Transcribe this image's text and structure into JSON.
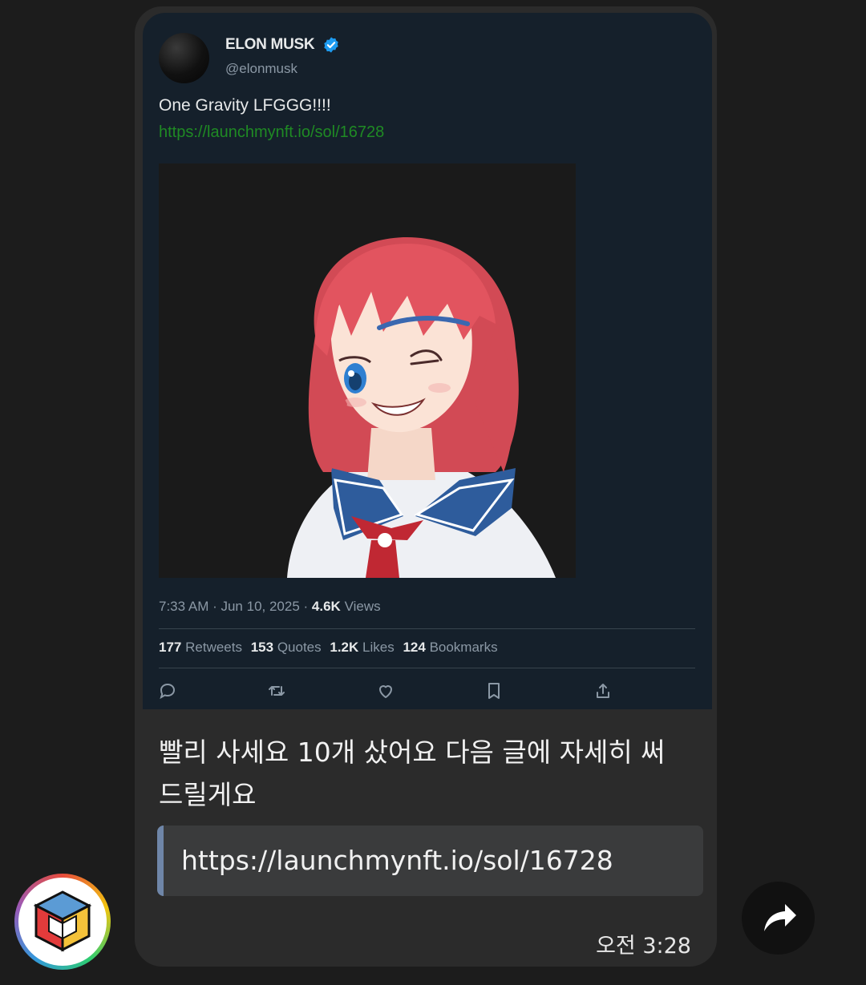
{
  "tweet": {
    "author_name": "ELON MUSK",
    "handle": "@elonmusk",
    "text": "One Gravity LFGGG!!!!",
    "link": "https://launchmynft.io/sol/16728",
    "time": "7:33 AM · Jun 10, 2025 ·",
    "views_count": "4.6K",
    "views_label": "Views",
    "stats": [
      {
        "count": "177",
        "label": "Retweets"
      },
      {
        "count": "153",
        "label": "Quotes"
      },
      {
        "count": "1.2K",
        "label": "Likes"
      },
      {
        "count": "124",
        "label": "Bookmarks"
      }
    ],
    "actions": [
      "reply-icon",
      "retweet-icon",
      "like-icon",
      "bookmark-icon",
      "share-icon"
    ]
  },
  "message": {
    "text": "빨리 사세요 10개 샀어요 다음 글에 자세히 써드릴게요",
    "link_preview": "https://launchmynft.io/sol/16728",
    "time": "오전 3:28"
  },
  "colors": {
    "background": "#1c1c1c",
    "bubble": "#2b2b2b",
    "tweet_bg": "#15202b",
    "link_green": "#1f8a24",
    "verified_blue": "#1d9bf0",
    "preview_bar": "#6f86a8"
  }
}
